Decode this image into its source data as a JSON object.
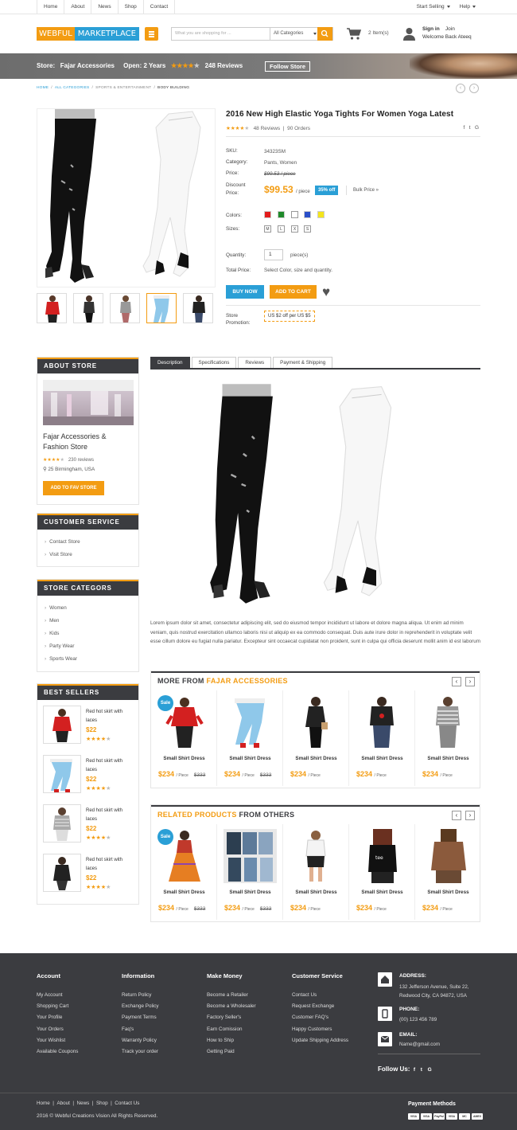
{
  "topbar": {
    "nav": [
      "Home",
      "About",
      "News",
      "Shop",
      "Contact"
    ],
    "start_selling": "Start Selling",
    "help": "Help"
  },
  "header": {
    "logo_part1": "WEBFUL",
    "logo_part2": "MARKETPLACE",
    "search_placeholder": "What you are shopping for ...",
    "search_category": "All Categories",
    "cart_items": "2 Item(s)",
    "sign_in": "Sign in",
    "join": "Join",
    "welcome": "Welcome Back Ateeq"
  },
  "storebar": {
    "store_label": "Store:",
    "store_name": "Fajar Accessories",
    "open_label": "Open:",
    "open_value": "2 Years",
    "reviews": "248 Reviews",
    "follow": "Follow Store",
    "rating": 4
  },
  "breadcrumb": [
    "HOME",
    "ALL CATEGORIES",
    "SPORTS & ENTERTAINMENT",
    "BODY BUILDING"
  ],
  "product": {
    "title": "2016 New High Elastic Yoga Tights For Women Yoga Latest",
    "rating": 4,
    "reviews": "48 Reviews",
    "orders": "90 Orders",
    "share": [
      "f",
      "t",
      "G"
    ],
    "sku_label": "SKU:",
    "sku": "34323SM",
    "category_label": "Category:",
    "category": "Pants, Women",
    "price_label": "Price:",
    "price_old": "$99.53 / piece",
    "discount_label": "Discount Price:",
    "discount_label_1": "Discount",
    "discount_label_2": "Price:",
    "price": "$99.53",
    "price_unit": "/ piece",
    "off": "35% off",
    "bulk": "Bulk Price »",
    "colors_label": "Colors:",
    "colors": [
      "#e31c1c",
      "#1f8a2a",
      "#ffffff",
      "#2a4fc8",
      "#f4e51c"
    ],
    "sizes_label": "Sizes:",
    "sizes": [
      "M",
      "L",
      "X",
      "S"
    ],
    "qty_label": "Quantity:",
    "qty": "1",
    "qty_unit": "piece(s)",
    "total_label": "Total Price:",
    "total_value": "Select Color, size and quantity.",
    "buy_now": "BUY NOW",
    "add_to_cart": "ADD TO CART",
    "promo_label_1": "Store",
    "promo_label_2": "Promotion:",
    "promo": "US $2 off per US $5"
  },
  "about_store": {
    "heading": "ABOUT STORE",
    "name_1": "Fajar Accessories &",
    "name_2": "Fashion Store",
    "rating": 4,
    "reviews": "230 reviews",
    "location": "25 Birmingham, USA",
    "fav_button": "ADD TO FAV STORE"
  },
  "customer_service": {
    "heading": "CUSTOMER SERVICE",
    "links": [
      "Contact Store",
      "Visit Store"
    ]
  },
  "store_categories": {
    "heading": "STORE CATEGORS",
    "links": [
      "Women",
      "Men",
      "Kids",
      "Party Wear",
      "Sports Wear"
    ]
  },
  "best_sellers": {
    "heading": "BEST SELLERS",
    "items": [
      {
        "name_1": "Red hot skirt with",
        "name_2": "laces",
        "price": "$22",
        "rating": 4
      },
      {
        "name_1": "Red hot skirt with",
        "name_2": "laces",
        "price": "$22",
        "rating": 4
      },
      {
        "name_1": "Red hot skirt with",
        "name_2": "laces",
        "price": "$22",
        "rating": 4
      },
      {
        "name_1": "Red hot skirt with",
        "name_2": "laces",
        "price": "$22",
        "rating": 4
      }
    ]
  },
  "tabs": [
    "Description",
    "Specifications",
    "Reviews",
    "Payment & Shipping"
  ],
  "description": "Lorem ipsum dolor sit amet, consectetur adipiscing elit, sed do eiusmod tempor incididunt ut labore et dolore magna aliqua. Ut enim ad minim veniam, quis nostrud exercitation ullamco laboris nisi ut aliquip ex ea commodo consequat. Duis aute irure dolor in reprehenderit in voluptate velit esse cillum dolore eu fugiat nulla pariatur. Excepteur sint occaecat cupidatat non proident, sunt in culpa qui officia deserunt mollit anim id est laborum",
  "more_from": {
    "title_prefix": "MORE FROM",
    "title_accent": "FAJAR ACCESSORIES",
    "products": [
      {
        "name": "Small Shirt Dress",
        "price": "$234",
        "unit": "/ Piece",
        "old": "$333",
        "sale": "Sale"
      },
      {
        "name": "Small Shirt Dress",
        "price": "$234",
        "unit": "/ Piece",
        "old": "$333"
      },
      {
        "name": "Small Shirt Dress",
        "price": "$234",
        "unit": "/ Piece",
        "old": ""
      },
      {
        "name": "Small Shirt Dress",
        "price": "$234",
        "unit": "/ Piece",
        "old": ""
      },
      {
        "name": "Small Shirt Dress",
        "price": "$234",
        "unit": "/ Piece",
        "old": ""
      }
    ]
  },
  "related": {
    "title_accent": "RELATED PRODUCTS",
    "title_suffix": "FROM OTHERS",
    "products": [
      {
        "name": "Small Shirt Dress",
        "price": "$234",
        "unit": "/ Piece",
        "old": "$333",
        "sale": "Sale"
      },
      {
        "name": "Small Shirt Dress",
        "price": "$234",
        "unit": "/ Piece",
        "old": "$333"
      },
      {
        "name": "Small Shirt Dress",
        "price": "$234",
        "unit": "/ Piece",
        "old": ""
      },
      {
        "name": "Small Shirt Dress",
        "price": "$234",
        "unit": "/ Piece",
        "old": ""
      },
      {
        "name": "Small Shirt Dress",
        "price": "$234",
        "unit": "/ Piece",
        "old": ""
      }
    ]
  },
  "footer": {
    "account": {
      "heading": "Account",
      "links": [
        "My Account",
        "Shopping Cart",
        "Your Profile",
        "Your Orders",
        "Your Wishlist",
        "Available Coupons"
      ]
    },
    "information": {
      "heading": "Information",
      "links": [
        "Return Policy",
        "Exchange Policy",
        "Payment Terms",
        "Faq's",
        "Warranty Policy",
        "Track your order"
      ]
    },
    "make_money": {
      "heading": "Make Money",
      "links": [
        "Become a Retailer",
        "Become a Wholesaler",
        "Factory Seller's",
        "Earn Comission",
        "How to Ship",
        "Getting Paid"
      ]
    },
    "customer_service": {
      "heading": "Customer Service",
      "links": [
        "Contact Us",
        "Request Exchange",
        "Customer FAQ's",
        "Happy Customers",
        "Update Shipping Address"
      ]
    },
    "address_label": "ADDRESS:",
    "address_1": "132 Jefferson Avenue, Suite 22,",
    "address_2": "Redwood City, CA 94872, USA",
    "phone_label": "PHONE:",
    "phone": "(00) 123 456 789",
    "email_label": "EMAIL:",
    "email": "Name@gmail.com",
    "follow_us": "Follow Us:",
    "social": [
      "f",
      "t",
      "G"
    ],
    "bottom_nav": [
      "Home",
      "About",
      "News",
      "Shop",
      "Contact Us"
    ],
    "copyright": "2016 © Webful Creations Vision All Rights Reserved.",
    "payment_methods": "Payment Methods",
    "payment_icons": [
      "VISA",
      "VISA",
      "PayPal",
      "VISA",
      "MC",
      "AMEX"
    ]
  }
}
